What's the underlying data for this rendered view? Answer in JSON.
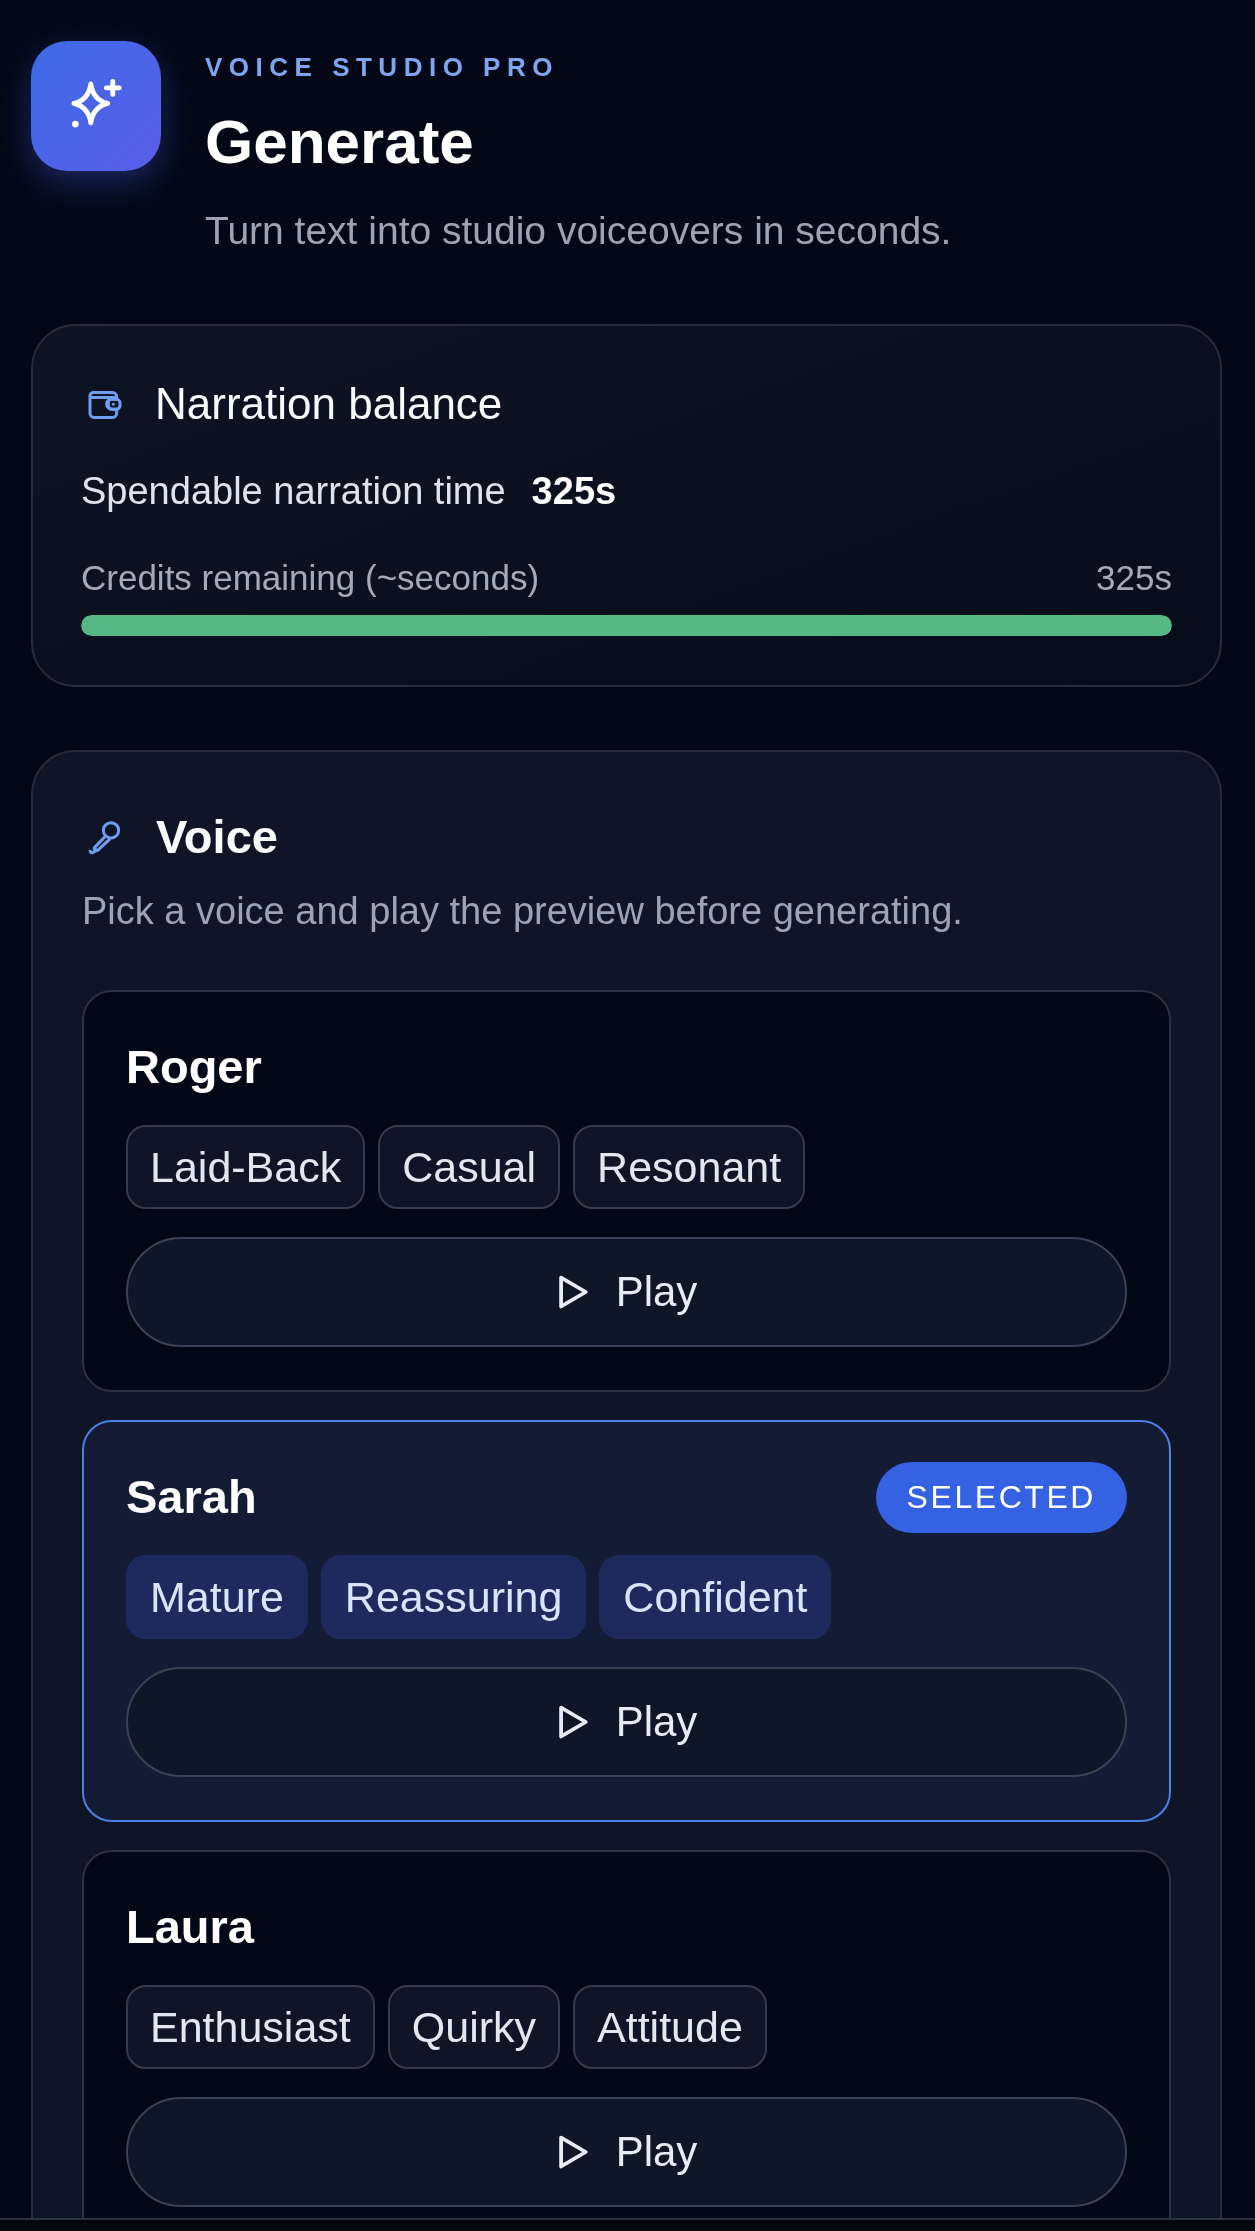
{
  "header": {
    "eyebrow": "VOICE STUDIO PRO",
    "title": "Generate",
    "subtitle": "Turn text into studio voiceovers in seconds."
  },
  "balance": {
    "title": "Narration balance",
    "spendable_label": "Spendable narration time",
    "spendable_value": "325s",
    "meter": {
      "label": "Credits remaining (~seconds)",
      "reading": "325s",
      "level": 1.0
    }
  },
  "voice_section": {
    "title": "Voice",
    "description": "Pick a voice and play the preview before generating.",
    "voices": [
      {
        "name": "Roger",
        "selected": false,
        "tags": [
          "Laid-Back",
          "Casual",
          "Resonant"
        ],
        "play_label": "Play"
      },
      {
        "name": "Sarah",
        "selected": true,
        "badge": "SELECTED",
        "tags": [
          "Mature",
          "Reassuring",
          "Confident"
        ],
        "play_label": "Play"
      },
      {
        "name": "Laura",
        "selected": false,
        "tags": [
          "Enthusiast",
          "Quirky",
          "Attitude"
        ],
        "play_label": "Play"
      }
    ]
  }
}
